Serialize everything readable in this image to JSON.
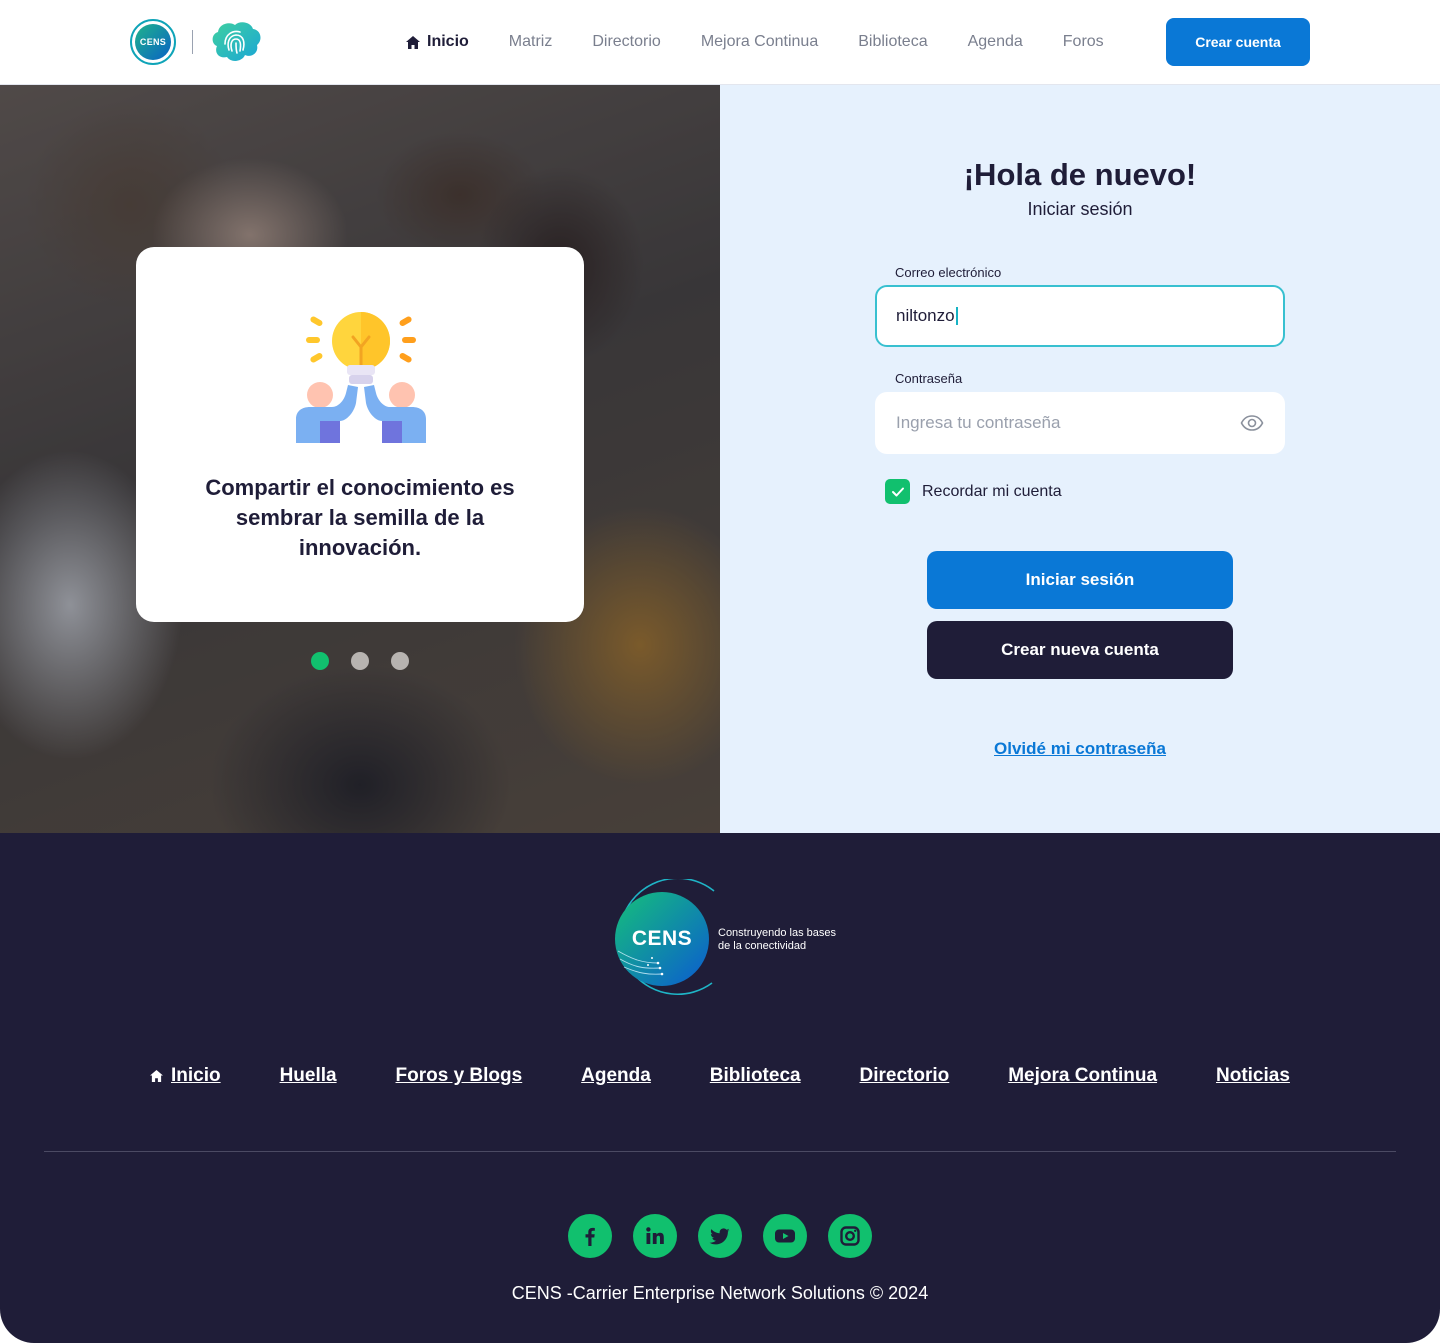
{
  "header": {
    "logo_text": "CENS",
    "nav": [
      {
        "label": "Inicio",
        "active": true,
        "icon": "home-icon"
      },
      {
        "label": "Matriz"
      },
      {
        "label": "Directorio"
      },
      {
        "label": "Mejora Continua"
      },
      {
        "label": "Biblioteca"
      },
      {
        "label": "Agenda"
      },
      {
        "label": "Foros"
      }
    ],
    "cta_label": "Crear cuenta"
  },
  "hero": {
    "quote": "Compartir el conocimiento es sembrar la semilla de la innovación.",
    "quote_icon": "lightbulb-teamwork-icon",
    "carousel": {
      "total": 3,
      "active": 1
    }
  },
  "login": {
    "title": "¡Hola de nuevo!",
    "subtitle": "Iniciar sesión",
    "email_label": "Correo electrónico",
    "email_value": "niltonzo",
    "password_label": "Contraseña",
    "password_placeholder": "Ingresa tu contraseña",
    "remember_label": "Recordar mi cuenta",
    "remember_checked": true,
    "login_button": "Iniciar sesión",
    "create_button": "Crear nueva cuenta",
    "forgot_link": "Olvidé mi contraseña"
  },
  "footer": {
    "logo_text": "CENS",
    "tagline_line1": "Construyendo las bases",
    "tagline_line2": "de la conectividad",
    "links": [
      "Inicio",
      "Huella",
      "Foros y Blogs",
      "Agenda",
      "Biblioteca",
      "Directorio",
      "Mejora Continua",
      "Noticias"
    ],
    "socials": [
      "facebook-icon",
      "linkedin-icon",
      "twitter-icon",
      "youtube-icon",
      "instagram-icon"
    ],
    "copyright": "CENS -Carrier Enterprise Network Solutions © 2024"
  },
  "colors": {
    "primary": "#0a78d6",
    "dark": "#1f1d38",
    "accent_green": "#11c06e",
    "login_bg": "#e6f1fd",
    "focus_border": "#38c0d0"
  }
}
